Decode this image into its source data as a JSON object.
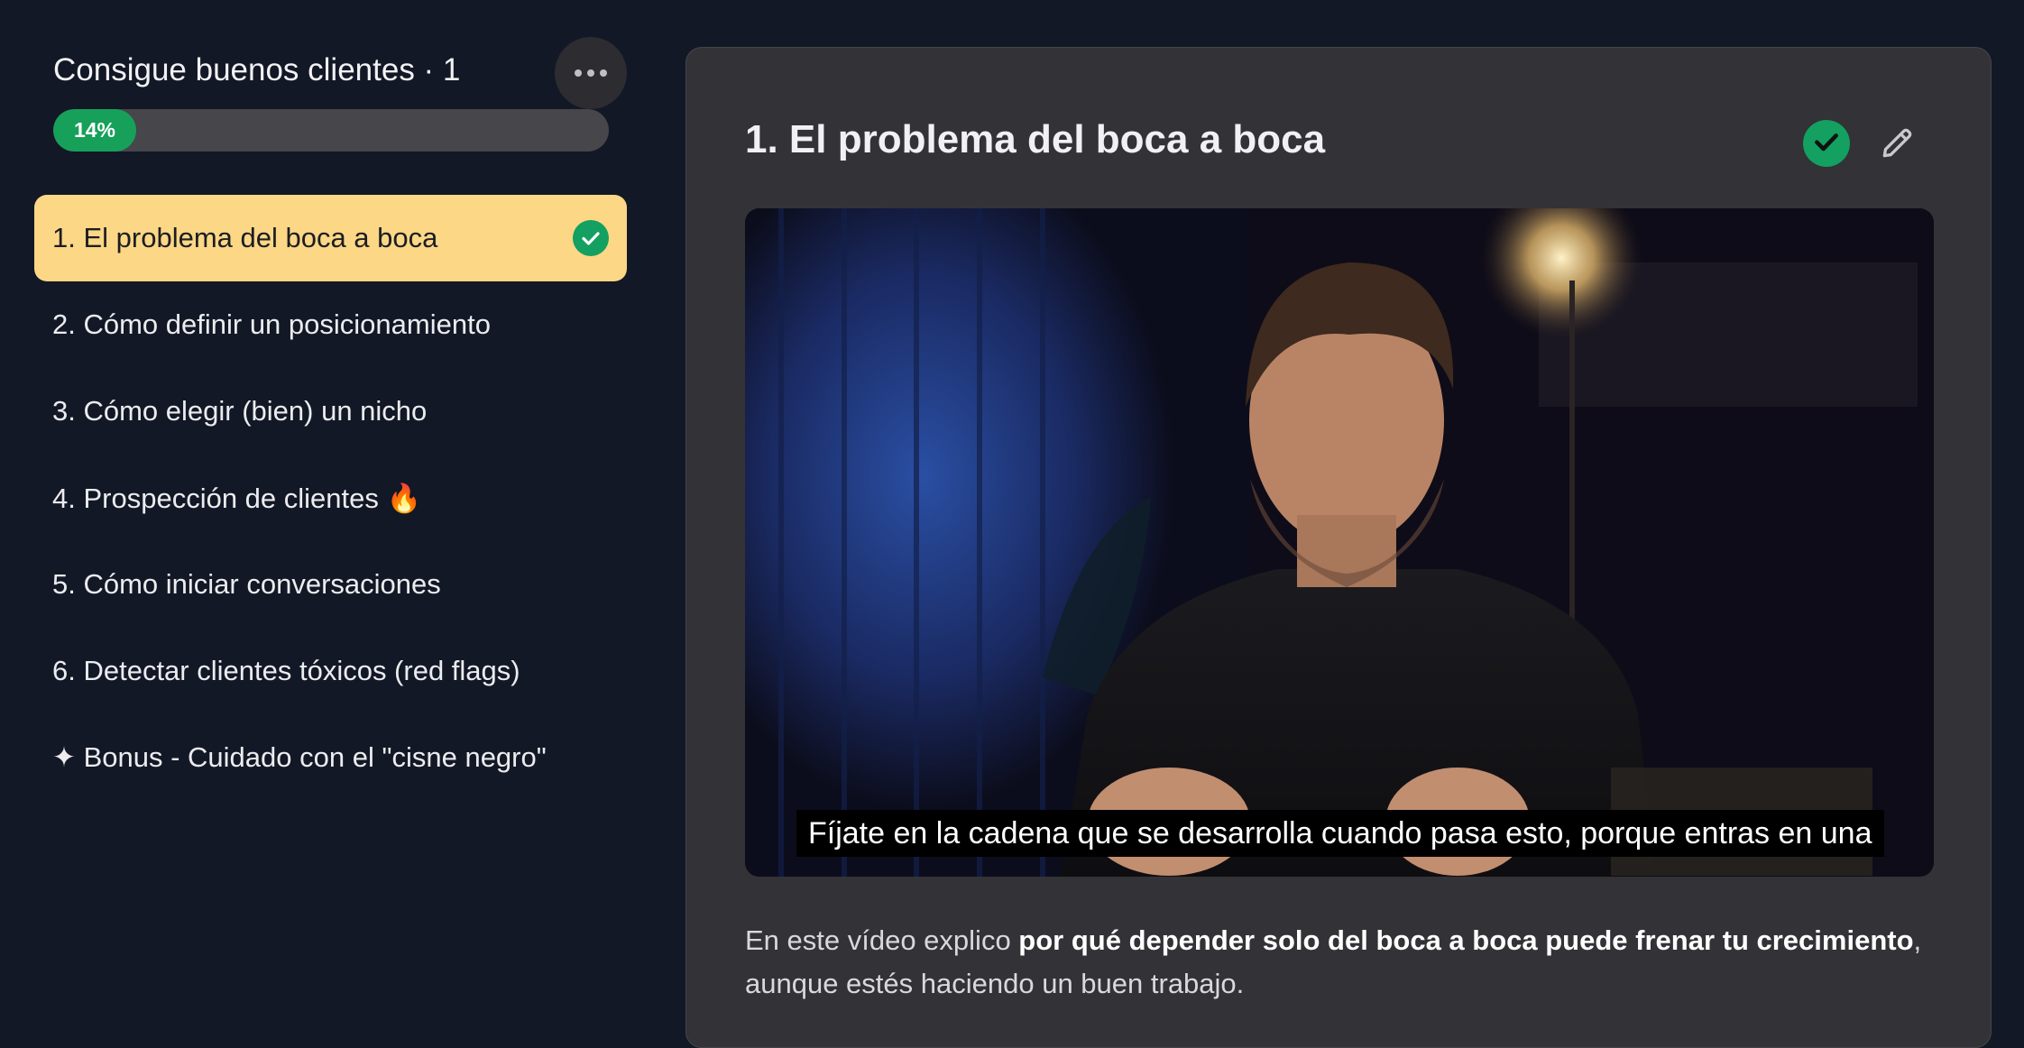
{
  "sidebar": {
    "course_title": "Consigue buenos clientes · 1",
    "more_icon": "ellipsis-icon",
    "progress": {
      "percent": 14,
      "label": "14%"
    },
    "lessons": [
      {
        "label": "1. El problema del boca a boca",
        "active": true,
        "completed": true
      },
      {
        "label": "2. Cómo definir un posicionamiento"
      },
      {
        "label": "3. Cómo elegir (bien) un nicho"
      },
      {
        "label": "4. Prospección de clientes 🔥"
      },
      {
        "label": "5. Cómo iniciar conversaciones"
      },
      {
        "label": "6. Detectar clientes tóxicos (red flags)"
      },
      {
        "label": "✦ Bonus - Cuidado con el \"cisne negro\""
      }
    ]
  },
  "main": {
    "lesson_title": "1. El problema del boca a boca",
    "complete_icon": "check-circle-icon",
    "edit_icon": "pencil-icon",
    "video": {
      "caption": "Fíjate en la cadena que se desarrolla cuando pasa esto, porque entras en una"
    },
    "description": {
      "before": "En este vídeo explico ",
      "bold": "por qué depender solo del boca a boca puede frenar tu crecimiento",
      "after": ", aunque estés haciendo un buen trabajo."
    }
  },
  "colors": {
    "background": "#121826",
    "active_lesson": "#fbd786",
    "success": "#13a060",
    "card": "#333236"
  }
}
